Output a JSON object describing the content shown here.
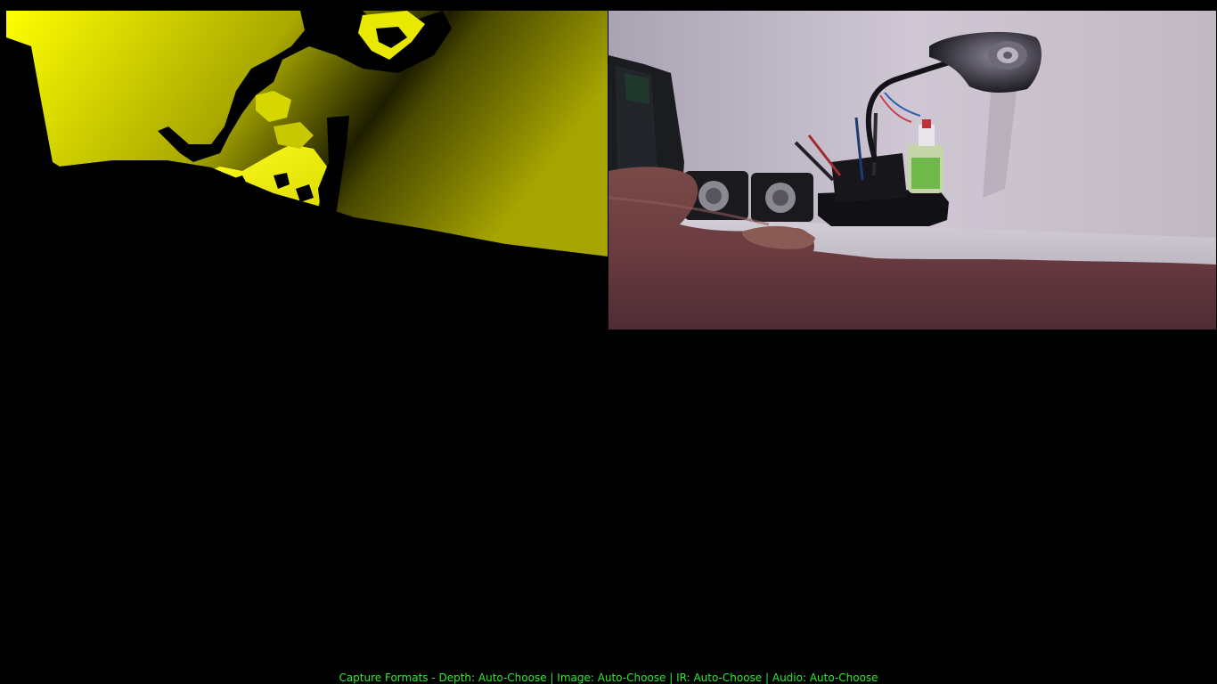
{
  "status_bar": {
    "text": "Capture Formats - Depth: Auto-Choose | Image: Auto-Choose | IR: Auto-Choose | Audio: Auto-Choose"
  },
  "colors": {
    "background": "#000000",
    "depth_bright": "#ffff00",
    "depth_dark": "#7a7a00",
    "status_text": "#2ee82e"
  }
}
